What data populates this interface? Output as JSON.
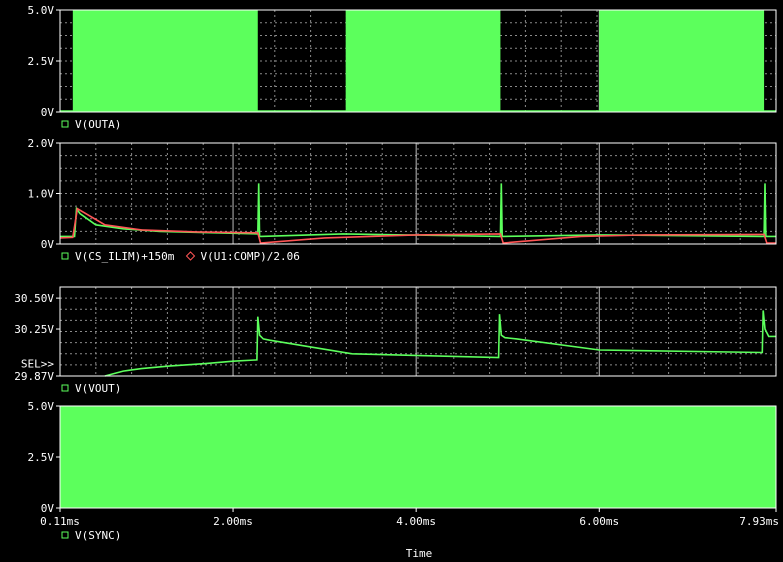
{
  "chart_data": {
    "type": "line",
    "xlabel": "Time",
    "xlim": [
      0.11,
      7.93
    ],
    "xticks": [
      "0.11ms",
      "2.00ms",
      "4.00ms",
      "6.00ms",
      "7.93ms"
    ],
    "xtick_values": [
      0.11,
      2.0,
      4.0,
      6.0,
      7.93
    ],
    "x_unit": "ms",
    "colors": {
      "background": "#000000",
      "green": "#5cff5c",
      "red": "#ff5555",
      "grid": "#8a8a8a",
      "text": "#ffffff"
    },
    "panels": [
      {
        "ylim": [
          0,
          5
        ],
        "yticks": [
          {
            "v": 0,
            "label": "0V"
          },
          {
            "v": 2.5,
            "label": "2.5V"
          },
          {
            "v": 5.0,
            "label": "5.0V"
          }
        ],
        "legend": [
          {
            "marker": "square",
            "color": "#5cff5c",
            "label": "V(OUTA)"
          }
        ],
        "series": [
          {
            "name": "V(OUTA)",
            "color": "#5cff5c",
            "fill": "band",
            "low": 0,
            "high": 5,
            "bursts": [
              [
                0.25,
                2.27
              ],
              [
                3.23,
                4.92
              ],
              [
                6.0,
                7.8
              ]
            ]
          }
        ]
      },
      {
        "ylim": [
          0,
          2
        ],
        "yticks": [
          {
            "v": 0,
            "label": "0V"
          },
          {
            "v": 1.0,
            "label": "1.0V"
          },
          {
            "v": 2.0,
            "label": "2.0V"
          }
        ],
        "legend": [
          {
            "marker": "square",
            "color": "#5cff5c",
            "label": "V(CS_ILIM)+150m"
          },
          {
            "marker": "diamond",
            "color": "#ff5555",
            "label": "V(U1:COMP)/2.06"
          }
        ],
        "series": [
          {
            "name": "V(CS_ILIM)+150m",
            "color": "#5cff5c",
            "x": [
              0.11,
              0.27,
              0.29,
              0.33,
              0.5,
              0.8,
              1.2,
              2.27,
              2.28,
              2.29,
              2.3,
              3.2,
              4.92,
              4.93,
              4.94,
              4.95,
              6.0,
              7.8,
              7.81,
              7.82,
              7.83,
              7.93
            ],
            "y": [
              0.15,
              0.15,
              0.7,
              0.6,
              0.38,
              0.3,
              0.25,
              0.2,
              1.2,
              0.15,
              0.15,
              0.2,
              0.15,
              1.2,
              0.15,
              0.15,
              0.18,
              0.15,
              1.2,
              0.15,
              0.15,
              0.15
            ]
          },
          {
            "name": "V(U1:COMP)/2.06",
            "color": "#ff5555",
            "x": [
              0.11,
              0.25,
              0.3,
              0.6,
              1.0,
              1.6,
              2.27,
              2.3,
              3.0,
              4.0,
              4.92,
              4.95,
              5.8,
              6.5,
              7.8,
              7.83,
              7.93
            ],
            "y": [
              0.12,
              0.13,
              0.7,
              0.38,
              0.28,
              0.24,
              0.22,
              0.02,
              0.12,
              0.18,
              0.2,
              0.02,
              0.15,
              0.18,
              0.19,
              0.02,
              0.02
            ]
          }
        ]
      },
      {
        "ylim": [
          29.87,
          30.59
        ],
        "yticks": [
          {
            "v": 29.87,
            "label": "29.87V"
          },
          {
            "v": 30.25,
            "label": "30.25V"
          },
          {
            "v": 30.5,
            "label": "30.50V"
          }
        ],
        "sel_label": "SEL>>",
        "sel_value": 29.97,
        "legend": [
          {
            "marker": "square",
            "color": "#5cff5c",
            "label": "V(VOUT)"
          }
        ],
        "series": [
          {
            "name": "V(VOUT)",
            "color": "#5cff5c",
            "x": [
              0.6,
              0.8,
              1.0,
              1.3,
              1.7,
              2.0,
              2.26,
              2.27,
              2.29,
              2.33,
              2.4,
              3.3,
              4.9,
              4.91,
              4.93,
              4.97,
              5.1,
              6.0,
              7.78,
              7.79,
              7.81,
              7.85,
              7.93
            ],
            "y": [
              29.87,
              29.91,
              29.93,
              29.95,
              29.97,
              29.99,
              30.0,
              30.35,
              30.2,
              30.17,
              30.16,
              30.05,
              30.02,
              30.37,
              30.2,
              30.18,
              30.17,
              30.08,
              30.06,
              30.4,
              30.25,
              30.19,
              30.19
            ]
          }
        ]
      },
      {
        "ylim": [
          0,
          5
        ],
        "yticks": [
          {
            "v": 0,
            "label": "0V"
          },
          {
            "v": 2.5,
            "label": "2.5V"
          },
          {
            "v": 5.0,
            "label": "5.0V"
          }
        ],
        "legend": [
          {
            "marker": "square",
            "color": "#5cff5c",
            "label": "V(SYNC)"
          }
        ],
        "series": [
          {
            "name": "V(SYNC)",
            "color": "#5cff5c",
            "fill": "band",
            "low": 0,
            "high": 5,
            "bursts": [
              [
                0.11,
                7.93
              ]
            ]
          }
        ]
      }
    ]
  }
}
